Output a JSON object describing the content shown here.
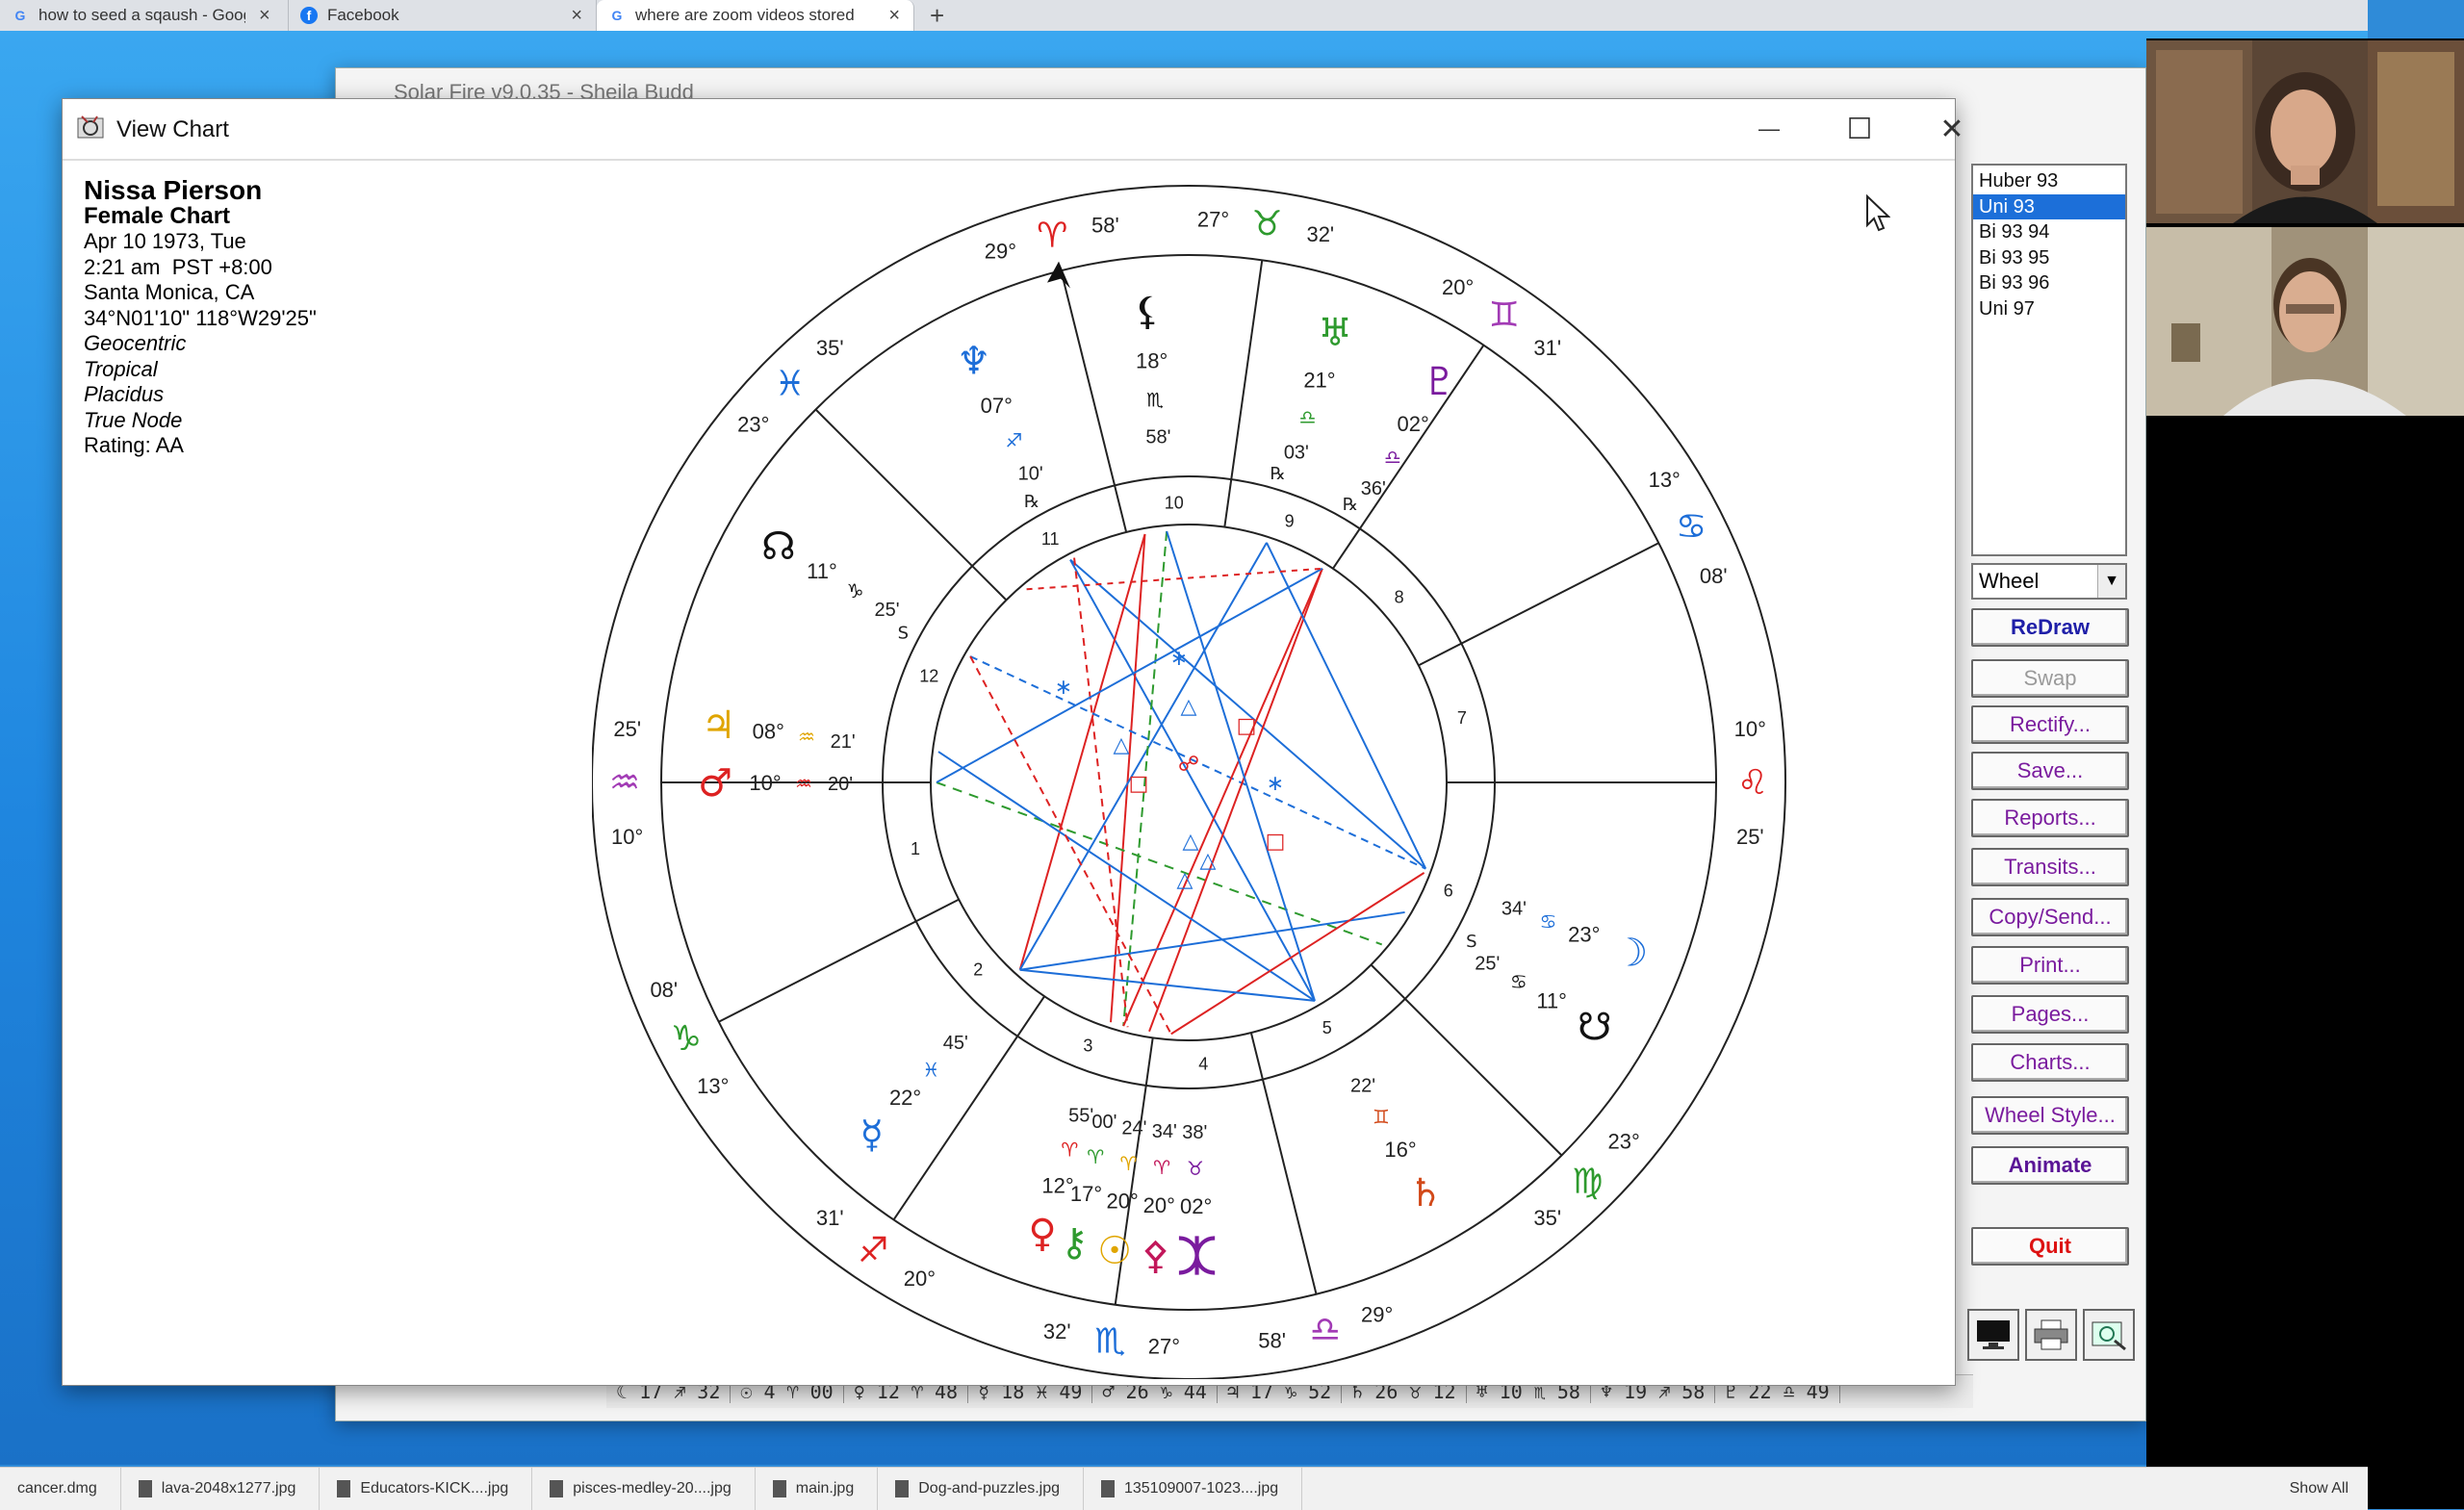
{
  "browser": {
    "tabs": [
      {
        "label": "how to seed a sqaush - Google",
        "icon": "google-icon"
      },
      {
        "label": "Facebook",
        "icon": "facebook-icon"
      },
      {
        "label": "where are zoom videos stored",
        "icon": "google-icon"
      }
    ],
    "new_tab": "+"
  },
  "background_window": {
    "title": "Solar Fire v9.0.35 - Sheila Budd",
    "status_items": [
      "☾ 17 ♐ 32",
      "☉ 4 ♈ 00",
      "♀ 12 ♈ 48",
      "☿ 18 ♓ 49",
      "♂ 26 ♑ 44",
      "♃ 17 ♑ 52",
      "♄ 26 ♉ 12",
      "♅ 10 ♏ 58",
      "♆ 19 ♐ 58",
      "♇ 22 ♎ 49"
    ]
  },
  "window": {
    "title": "View Chart",
    "controls": {
      "minimize": "—",
      "maximize": "☐",
      "close": "✕"
    }
  },
  "chart_info": {
    "name": "Nissa Pierson",
    "chart_type": "Female Chart",
    "date": "Apr 10 1973, Tue",
    "time": "2:21 am  PST +8:00",
    "place": "Santa Monica, CA",
    "coords": "34°N01'10\" 118°W29'25\"",
    "system1": "Geocentric",
    "system2": "Tropical",
    "system3": "Placidus",
    "system4": "True Node",
    "rating": "Rating: AA"
  },
  "wheel": {
    "house_numbers": [
      "1",
      "2",
      "3",
      "4",
      "5",
      "6",
      "7",
      "8",
      "9",
      "10",
      "11",
      "12"
    ],
    "cusps": [
      {
        "deg": "10°",
        "sign": "♒",
        "min": "25'",
        "color": "#a23bb5"
      },
      {
        "deg": "13°",
        "sign": "♑",
        "min": "08'",
        "color": "#2e9a2e"
      },
      {
        "deg": "20°",
        "sign": "♐",
        "min": "31'",
        "color": "#d22"
      },
      {
        "deg": "27°",
        "sign": "♏",
        "min": "32'",
        "color": "#1d6ed8"
      },
      {
        "deg": "29°",
        "sign": "♎",
        "min": "58'",
        "color": "#a23bb5"
      },
      {
        "deg": "23°",
        "sign": "♍",
        "min": "35'",
        "color": "#2e9a2e"
      },
      {
        "deg": "10°",
        "sign": "♌",
        "min": "25'",
        "color": "#d22"
      },
      {
        "deg": "13°",
        "sign": "♋",
        "min": "08'",
        "color": "#1d6ed8"
      },
      {
        "deg": "20°",
        "sign": "♊",
        "min": "31'",
        "color": "#a23bb5"
      },
      {
        "deg": "27°",
        "sign": "♉",
        "min": "32'",
        "color": "#2e9a2e"
      },
      {
        "deg": "29°",
        "sign": "♈",
        "min": "58'",
        "color": "#d22"
      },
      {
        "deg": "23°",
        "sign": "♓",
        "min": "35'",
        "color": "#1d6ed8"
      }
    ],
    "planets": [
      {
        "glyph": "♆",
        "deg": "07°",
        "sign": "♐",
        "min": "10'",
        "retro": "℞",
        "color": "#1d6ed8"
      },
      {
        "glyph": "⚸",
        "deg": "18°",
        "sign": "♏",
        "min": "58'",
        "retro": "",
        "color": "#111"
      },
      {
        "glyph": "♅",
        "deg": "21°",
        "sign": "♎",
        "min": "03'",
        "retro": "℞",
        "color": "#2e9a2e"
      },
      {
        "glyph": "♇",
        "deg": "02°",
        "sign": "♎",
        "min": "36'",
        "retro": "℞",
        "color": "#7a1b9e"
      },
      {
        "glyph": "☊",
        "deg": "11°",
        "sign": "♑",
        "min": "25'",
        "retro": "S",
        "color": "#111"
      },
      {
        "glyph": "♃",
        "deg": "08°",
        "sign": "♒",
        "min": "21'",
        "retro": "",
        "color": "#e0a500"
      },
      {
        "glyph": "♂",
        "deg": "10°",
        "sign": "♒",
        "min": "20'",
        "retro": "",
        "color": "#d22"
      },
      {
        "glyph": "☽",
        "deg": "23°",
        "sign": "♋",
        "min": "34'",
        "retro": "",
        "color": "#1d6ed8"
      },
      {
        "glyph": "☋",
        "deg": "11°",
        "sign": "♋",
        "min": "25'",
        "retro": "S",
        "color": "#111"
      },
      {
        "glyph": "♄",
        "deg": "16°",
        "sign": "♊",
        "min": "22'",
        "retro": "",
        "color": "#d24a1a"
      },
      {
        "glyph": "☿",
        "deg": "22°",
        "sign": "♓",
        "min": "45'",
        "retro": "",
        "color": "#1d6ed8"
      },
      {
        "glyph": "♀",
        "deg": "12°",
        "sign": "♈",
        "min": "55'",
        "retro": "",
        "color": "#d22"
      },
      {
        "glyph": "⚷",
        "deg": "17°",
        "sign": "♈",
        "min": "00'",
        "retro": "",
        "color": "#2e9a2e"
      },
      {
        "glyph": "☉",
        "deg": "20°",
        "sign": "♈",
        "min": "24'",
        "retro": "",
        "color": "#e0a500"
      },
      {
        "glyph": "⚴",
        "deg": "20°",
        "sign": "♈",
        "min": "34'",
        "retro": "",
        "color": "#c2185b"
      },
      {
        "glyph": "⯰",
        "deg": "02°",
        "sign": "♉",
        "min": "38'",
        "retro": "",
        "color": "#7a1b9e"
      }
    ]
  },
  "panel": {
    "list": [
      "Huber 93",
      "Uni 93",
      "Bi 93 94",
      "Bi 93 95",
      "Bi 93 96",
      "Uni 97"
    ],
    "selected_index": 1,
    "style_select": "Wheel",
    "buttons": {
      "redraw": "ReDraw",
      "swap": "Swap",
      "rectify": "Rectify...",
      "save": "Save...",
      "reports": "Reports...",
      "transits": "Transits...",
      "copy_send": "Copy/Send...",
      "print": "Print...",
      "pages": "Pages...",
      "charts": "Charts...",
      "wheel_style": "Wheel Style...",
      "animate": "Animate",
      "quit": "Quit"
    },
    "icon_buttons": [
      "monitor-icon",
      "printer-icon",
      "export-icon"
    ]
  },
  "zoom": {
    "participants": [
      "participant-video-1",
      "participant-video-2"
    ]
  },
  "downloads": {
    "items": [
      "cancer.dmg",
      "lava-2048x1277.jpg",
      "Educators-KICK....jpg",
      "pisces-medley-20....jpg",
      "main.jpg",
      "Dog-and-puzzles.jpg",
      "135109007-1023....jpg"
    ],
    "show_all": "Show All"
  }
}
